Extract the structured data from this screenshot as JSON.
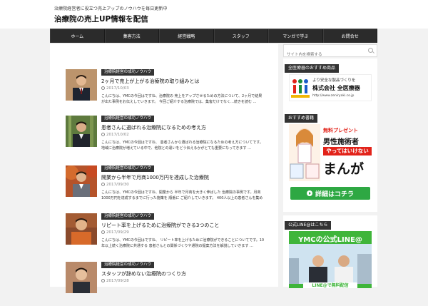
{
  "header": {
    "tagline": "治療院経営者に役立つ売上アップのノウハウを毎日更新中",
    "site_title": "治療院の売上UP情報を配信"
  },
  "nav": {
    "items": [
      "ホーム",
      "集客方法",
      "経営戦略",
      "スタッフ",
      "マンガで学ぶ",
      "お問合せ"
    ]
  },
  "posts": [
    {
      "category": "治療院経営の成功ノウハウ",
      "title": "2ヶ月で売上が上がる治療院の取り組みとは",
      "date": "2017/10/03",
      "excerpt": "こんにちは、YMCの今回はですね、治療院の 売上をアップさせるための方法について、2ヶ月で結果が出た事例をお伝えしていきます。 今回ご紹介する治療院では、集客だけでなく…続きを読む …"
    },
    {
      "category": "治療院経営の成功ノウハウ",
      "title": "患者さんに選ばれる治療院になるための考え方",
      "date": "2017/10/02",
      "excerpt": "こんにちは、YMCの今回はですね、 患者さんから選ばれる治療院になるための考え方についてです。 地域に治療院が増えている中で、他院との違いをどう伝えるかがとても重要になってきます …"
    },
    {
      "category": "治療院経営の成功ノウハウ",
      "title": "開業から半年で月商1000万円を達成した治療院",
      "date": "2017/09/30",
      "excerpt": "こんにちは、YMCの今回はですね、開業から 半年で月商を大きく伸ばした 治療院の事例です。月商1000万円を達成するまでに行った施策を 順番に ご紹介していきます。 400人以上の患者さんを集めた方法 …"
    },
    {
      "category": "治療院経営の成功ノウハウ",
      "title": "リピート率を上げるために治療院ができる3つのこと",
      "date": "2017/09/29",
      "excerpt": "こんにちは、YMCの今回はですね、 リピート率を上げるために治療院ができることについてです。10年以上続く治療院に共通する 患者さんとの関係づくりや通院の提案方法を解説していきます …"
    },
    {
      "category": "治療院経営の成功ノウハウ",
      "title": "スタッフが辞めない治療院のつくり方",
      "date": "2017/09/28",
      "excerpt": ""
    }
  ],
  "sidebar": {
    "search_placeholder": "サイト内を検索する",
    "sponsor_title": "全医療器のおすすめ商品",
    "sponsor_banner": {
      "line1": "より安全な製品づくりを",
      "company": "株式会社 全医療器",
      "url": "http://www.zeniryoki.co.jp"
    },
    "manga_title": "おすすめ書籍",
    "manga_banner": {
      "free": "無料プレゼント",
      "headline1": "男性施術者",
      "headline2": "やってはいけない",
      "big": "まんが",
      "cta": "詳細はコチラ"
    },
    "line_title": "公式LINE@はこちら",
    "line_banner": {
      "heading": "YMCの公式LINE@",
      "sub": "LINE@で無料配信"
    }
  },
  "colors": {
    "nav_bg": "#2b2b2b",
    "accent_red": "#e2231a",
    "cta_green": "#2ea843",
    "line_green": "#3fb53a"
  }
}
